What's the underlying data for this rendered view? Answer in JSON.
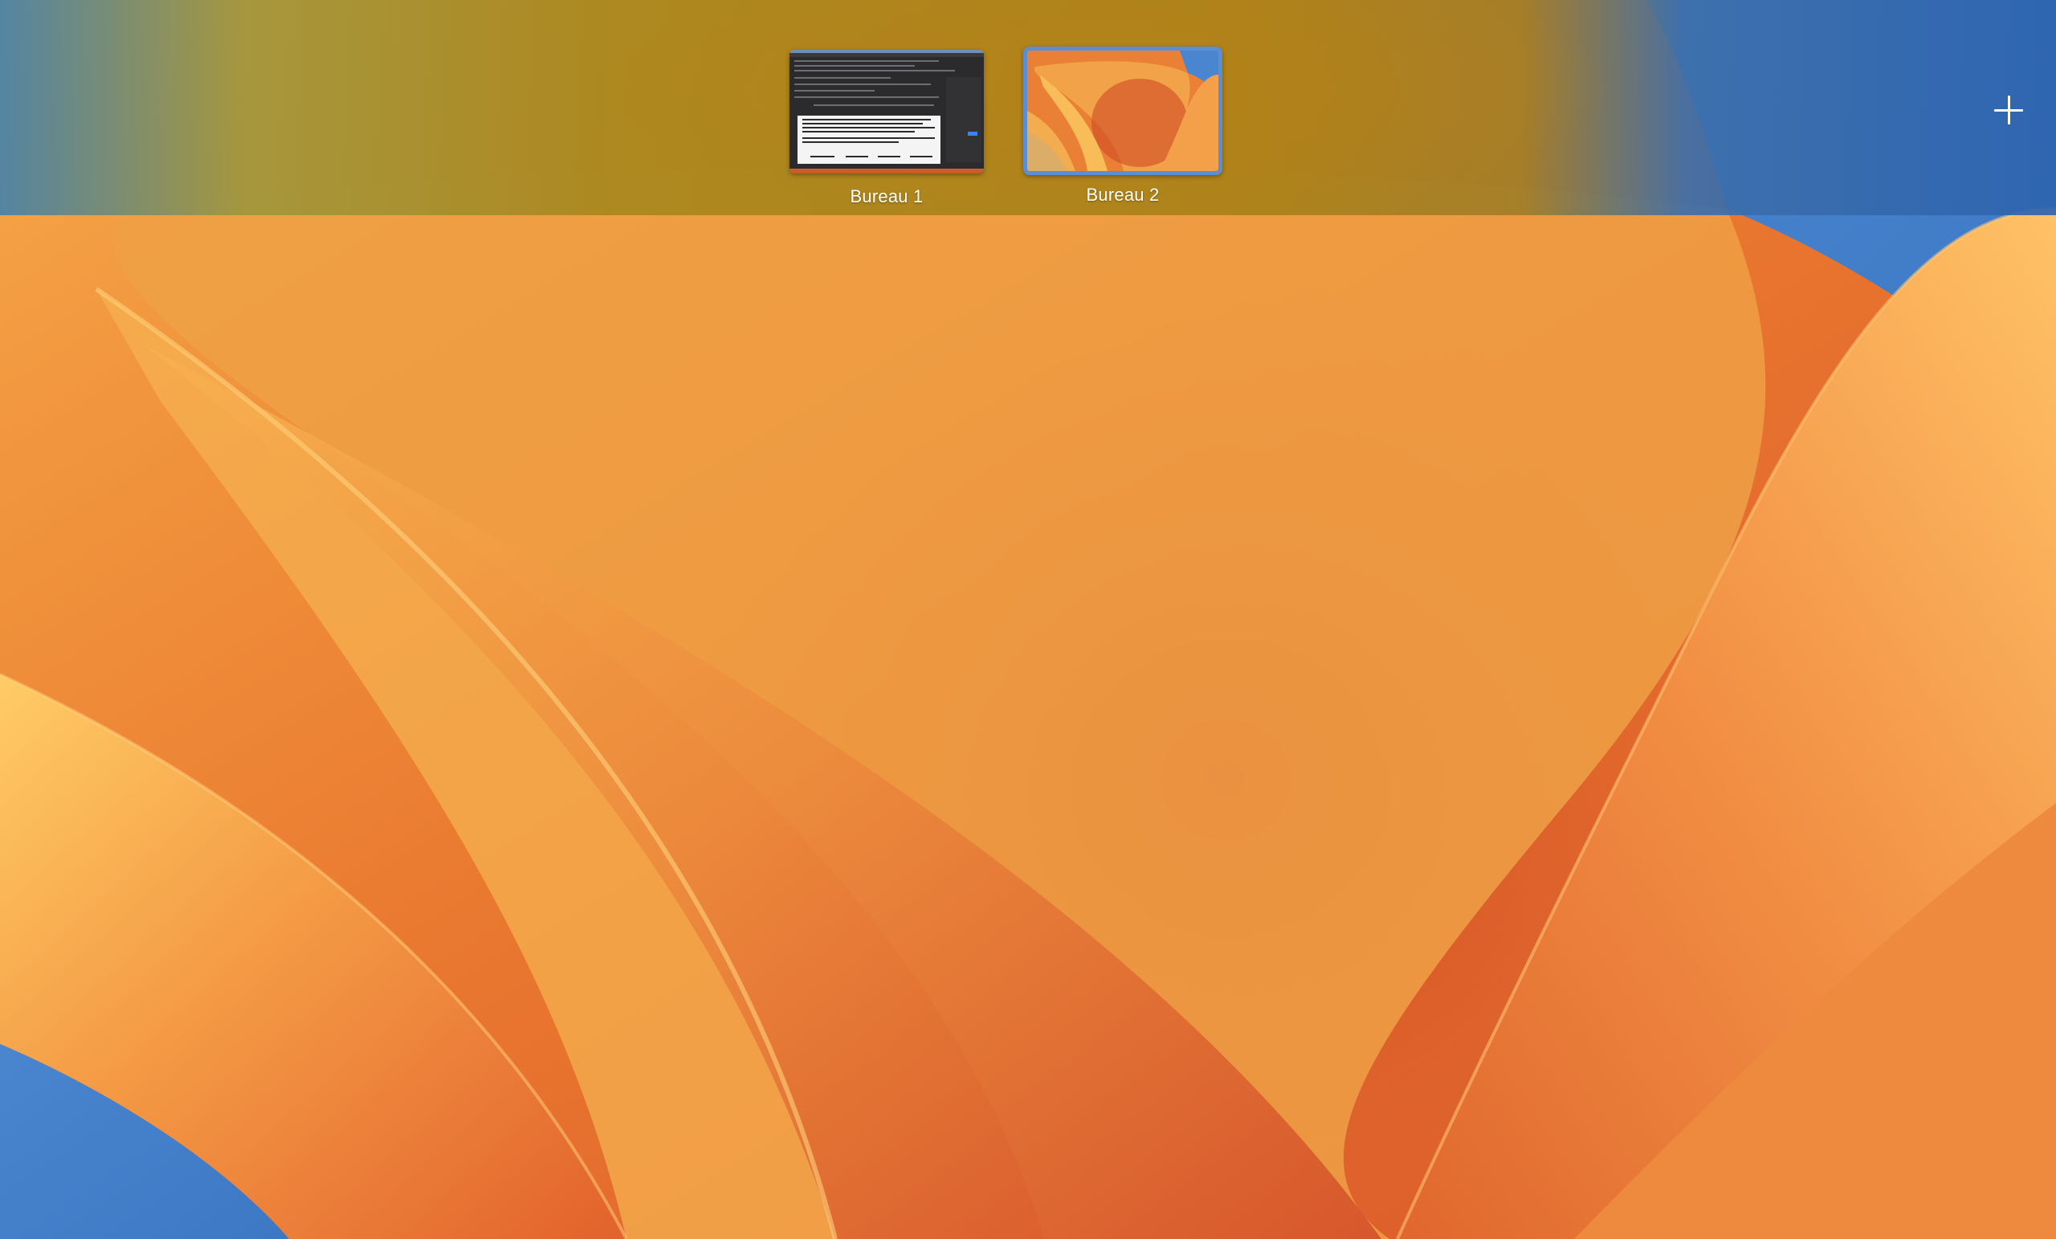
{
  "spaces_bar": {
    "spaces": [
      {
        "label": "Bureau 1",
        "selected": false
      },
      {
        "label": "Bureau 2",
        "selected": true
      }
    ],
    "add_space_icon": "plus-icon"
  },
  "colors": {
    "selected_space_border": "#5a8fd6",
    "label_text": "#ffffff"
  }
}
